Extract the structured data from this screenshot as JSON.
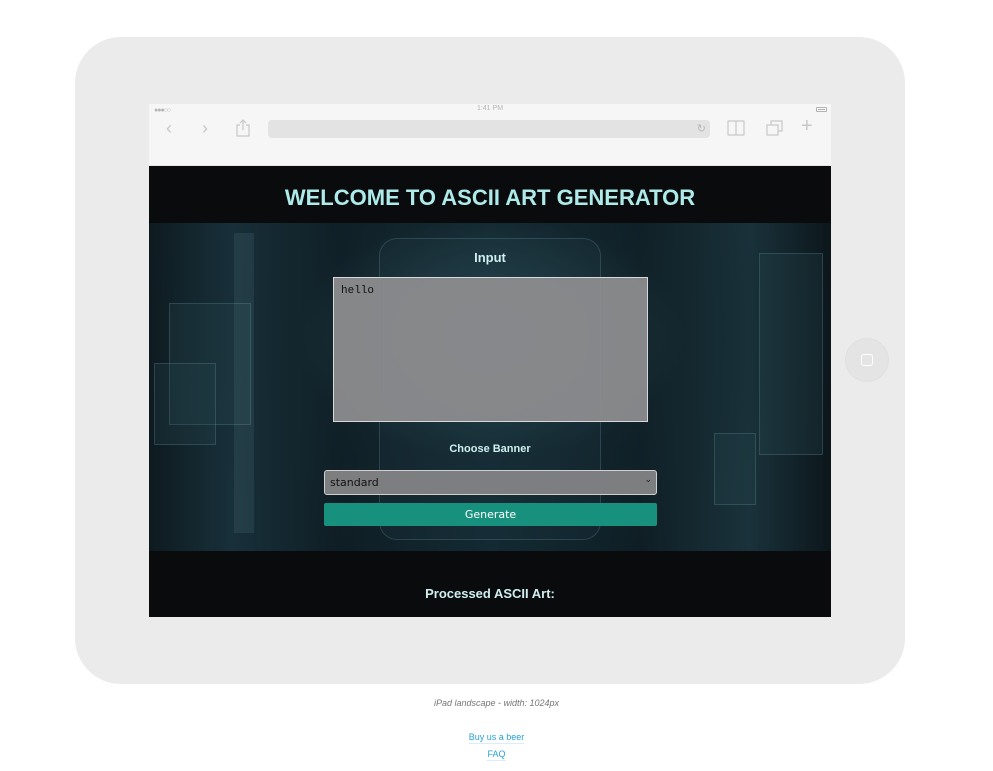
{
  "browser": {
    "status_time": "1:41 PM",
    "signal_dots": "●●●○○",
    "back_icon": "chevron-left-icon",
    "forward_icon": "chevron-right-icon",
    "share_icon": "share-icon",
    "reload_icon": "reload-icon",
    "bookmarks_icon": "book-icon",
    "tabs_icon": "tabs-icon",
    "new_tab_icon": "plus-icon"
  },
  "page": {
    "title": "WELCOME TO ASCII ART GENERATOR",
    "input_label": "Input",
    "input_value": "hello",
    "banner_label": "Choose Banner",
    "banner_selected": "standard",
    "generate_label": "Generate",
    "output_label": "Processed ASCII Art:"
  },
  "frame": {
    "caption": "iPad landscape - width: 1024px",
    "links": [
      "Buy us a beer",
      "FAQ"
    ]
  },
  "colors": {
    "title": "#aeeaea",
    "button": "#17917d",
    "link": "#2a9fd6"
  }
}
